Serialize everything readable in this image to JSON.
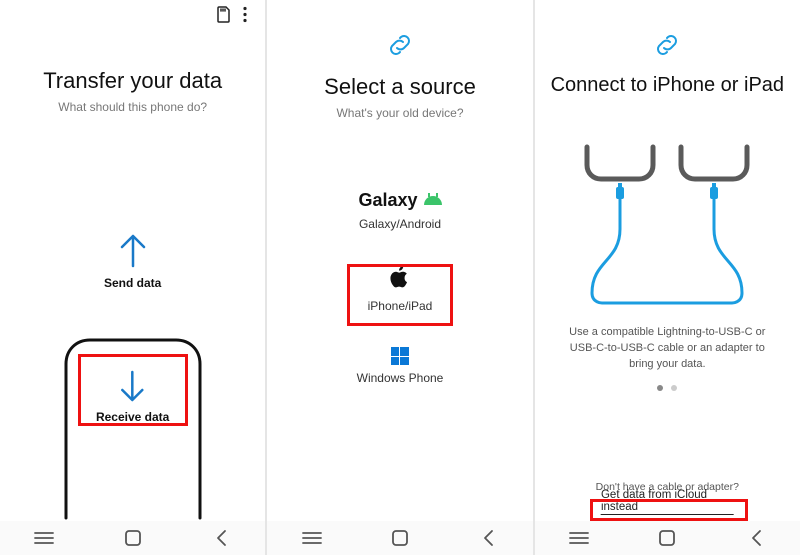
{
  "accent": "#1979c8",
  "pane1": {
    "title": "Transfer your data",
    "subtitle": "What should this phone do?",
    "send": "Send data",
    "receive": "Receive data"
  },
  "pane2": {
    "title": "Select a source",
    "subtitle": "What's your old device?",
    "galaxy_brand": "Galaxy",
    "galaxy": "Galaxy/Android",
    "iphone": "iPhone/iPad",
    "windows": "Windows Phone"
  },
  "pane3": {
    "title": "Connect to iPhone or iPad",
    "desc": "Use a compatible Lightning-to-USB-C or USB-C-to-USB-C cable or an adapter to bring your data.",
    "no_cable": "Don't have a cable or adapter?",
    "icloud": "Get data from iCloud instead"
  }
}
